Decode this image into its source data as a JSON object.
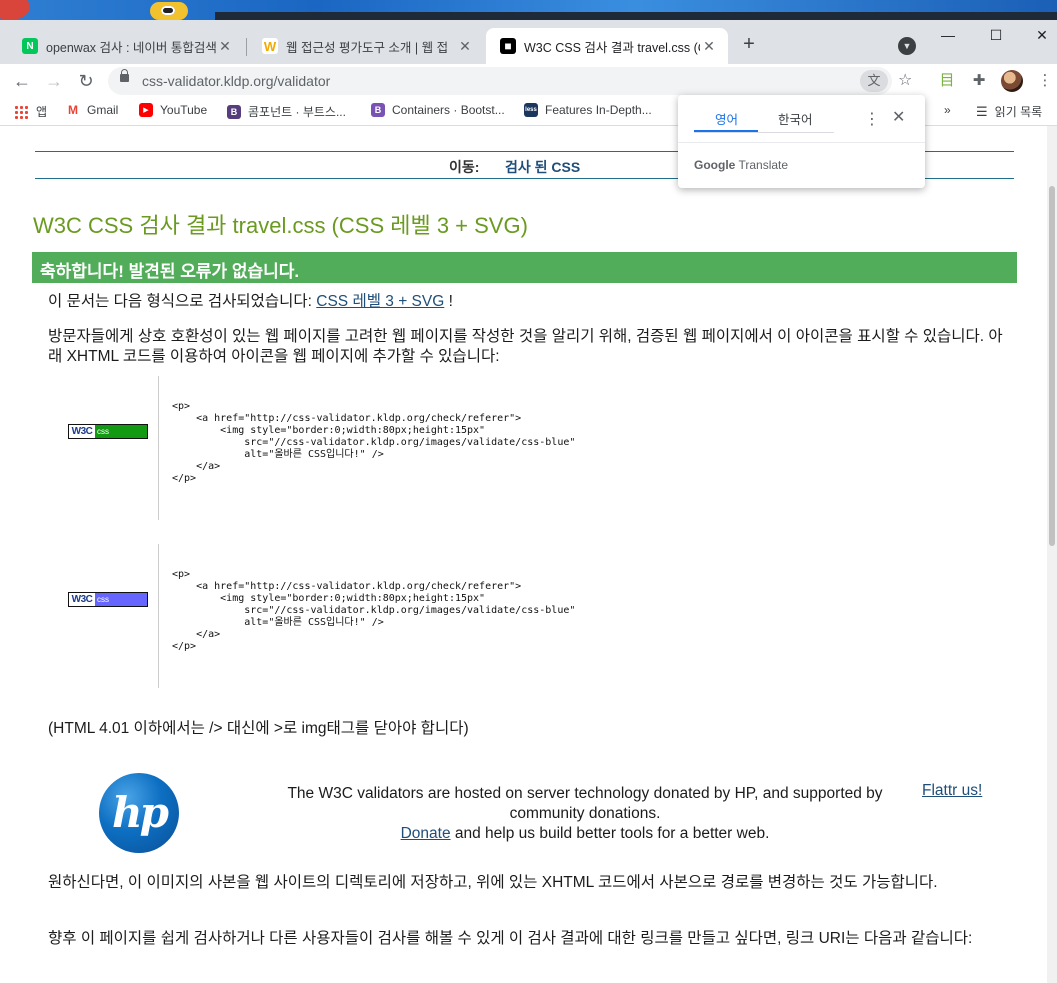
{
  "browser": {
    "tabs": [
      {
        "title": "openwax 검사 : 네이버 통합검색",
        "favicon": "N",
        "favicon_color": "#03c75a"
      },
      {
        "title": "웹 접근성 평가도구 소개 | 웹 접",
        "favicon": "W",
        "favicon_color": "#f2a900"
      },
      {
        "title": "W3C CSS 검사 결과 travel.css (C",
        "favicon": "■",
        "favicon_color": "#000000"
      }
    ],
    "url": "css-validator.kldp.org/validator",
    "bookmarks": [
      {
        "label": "앱",
        "icon": "apps-grid-icon"
      },
      {
        "label": "Gmail",
        "favicon": "M",
        "favicon_color": "#ea4335"
      },
      {
        "label": "YouTube",
        "favicon": "▶",
        "favicon_color": "#ff0000"
      },
      {
        "label": "콤포넌트 · 부트스...",
        "favicon": "B",
        "favicon_color": "#563d7c"
      },
      {
        "label": "Containers · Bootst...",
        "favicon": "B",
        "favicon_color": "#7952b3"
      },
      {
        "label": "Features In-Depth...",
        "favicon": "less",
        "favicon_color": "#1d365d"
      }
    ],
    "reading_list": "읽기 목록",
    "overflow": "»"
  },
  "translate_popup": {
    "source_lang": "영어",
    "target_lang": "한국어",
    "brand": "Google",
    "brand_suffix": "Translate"
  },
  "page": {
    "nav_label": "이동:",
    "nav_link": "검사 된 CSS",
    "title": "W3C CSS 검사 결과 travel.css (CSS 레벨 3 + SVG)",
    "congrats": "축하합니다! 발견된 오류가 없습니다.",
    "checked_prefix": "이 문서는 다음 형식으로 검사되었습니다: ",
    "checked_link": "CSS 레벨 3 + SVG",
    "checked_suffix": " !",
    "icon_intro": "방문자들에게 상호 호환성이 있는 웹 페이지를 고려한 웹 페이지를 작성한 것을 알리기 위해, 검증된 웹 페이지에서 이 아이콘을 표시할 수 있습니다. 아래 XHTML 코드를 이용하여 아이콘을 웹 페이지에 추가할 수 있습니다:",
    "badge_w3c": "W3C",
    "badge_css": "css",
    "badge_colors": [
      "#139a13",
      "#6666ff"
    ],
    "code_sample": "<p>\n    <a href=\"http://css-validator.kldp.org/check/referer\">\n        <img style=\"border:0;width:80px;height:15px\"\n            src=\"//css-validator.kldp.org/images/validate/css-blue\"\n            alt=\"올바른 CSS입니다!\" />\n    </a>\n</p>",
    "html401_note": "(HTML 4.01 이하에서는 /> 대신에 >로 img태그를 닫아야 합니다)",
    "hp_logo_text": "hp",
    "sponsor_text": "The W3C validators are hosted on server technology donated by HP, and supported by community donations.",
    "donate_link": "Donate",
    "donate_suffix": " and help us build better tools for a better web.",
    "flattr_link": "Flattr us!",
    "copy_note": "원하신다면, 이 이미지의 사본을 웹 사이트의 디렉토리에 저장하고, 위에 있는 XHTML 코드에서 사본으로 경로를 변경하는 것도 가능합니다.",
    "link_note": "향후 이 페이지를 쉽게 검사하거나 다른 사용자들이 검사를 해볼 수 있게 이 검사 결과에 대한 링크를 만들고 싶다면, 링크 URI는 다음과 같습니다:"
  }
}
